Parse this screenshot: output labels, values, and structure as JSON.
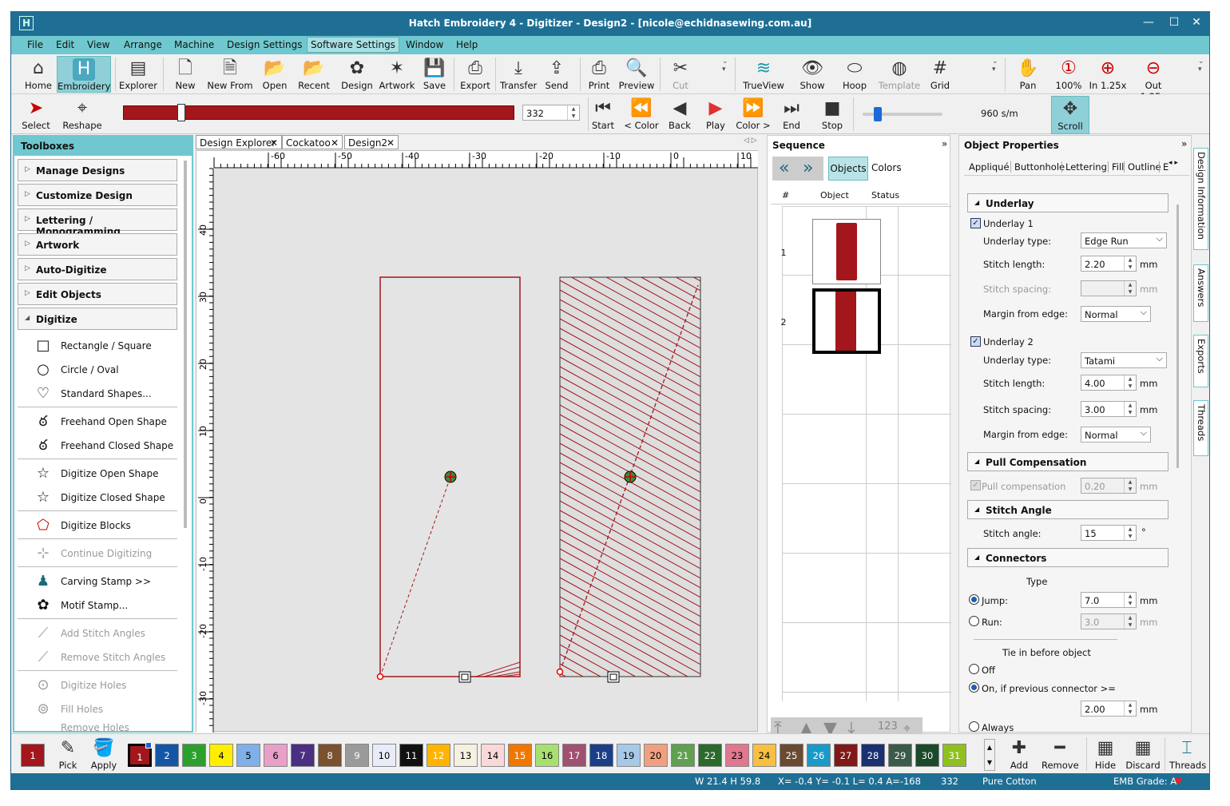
{
  "title": "Hatch Embroidery 4 - Digitizer - Design2 - [nicole@echidnasewing.com.au]",
  "menu": [
    "File",
    "Edit",
    "View",
    "Arrange",
    "Machine",
    "Design Settings",
    "Software Settings",
    "Window",
    "Help"
  ],
  "toolbar": {
    "home": "Home",
    "embroidery": "Embroidery",
    "explorer": "Explorer",
    "new": "New",
    "new_from": "New From",
    "open": "Open",
    "recent": "Recent",
    "design": "Design",
    "artwork": "Artwork",
    "save": "Save",
    "export": "Export",
    "transfer": "Transfer",
    "send": "Send",
    "print": "Print",
    "preview": "Preview",
    "cut": "Cut",
    "trueview": "TrueView",
    "show": "Show",
    "hoop": "Hoop",
    "template": "Template",
    "grid": "Grid",
    "pan": "Pan",
    "zoom100": "100%",
    "zoom_in": "In 1.25x",
    "zoom_out": "Out 1.25x"
  },
  "toolbar2": {
    "select": "Select",
    "reshape": "Reshape",
    "stitch_count": "332",
    "start": "Start",
    "prev_color": "< Color",
    "back": "Back",
    "play": "Play",
    "next_color": "Color >",
    "end": "End",
    "stop": "Stop",
    "speed": "960 s/m",
    "scroll": "Scroll",
    "slider_level": 0.1
  },
  "toolboxes": {
    "header": "Toolboxes",
    "categories": [
      "Manage Designs",
      "Customize Design",
      "Lettering / Monogramming",
      "Artwork",
      "Auto-Digitize",
      "Edit Objects",
      "Digitize"
    ],
    "tools": [
      "Rectangle / Square",
      "Circle / Oval",
      "Standard Shapes...",
      "Freehand Open Shape",
      "Freehand Closed Shape",
      "Digitize Open Shape",
      "Digitize Closed Shape",
      "Digitize Blocks",
      "Continue Digitizing",
      "Carving Stamp >>",
      "Motif Stamp...",
      "Add Stitch Angles",
      "Remove Stitch Angles",
      "Digitize Holes",
      "Fill Holes",
      "Remove Holes"
    ]
  },
  "doc_tabs": [
    "Design Explorer",
    "Cockatoo",
    "Design2"
  ],
  "ruler": {
    "h": [
      "-60",
      "-50",
      "-40",
      "-30",
      "-20",
      "-10",
      "0",
      "10"
    ],
    "v": [
      "40",
      "30",
      "20",
      "10",
      "0",
      "-10",
      "-20",
      "-30"
    ]
  },
  "sequence": {
    "title": "Sequence",
    "objects_tab": "Objects",
    "colors_tab": "Colors",
    "col_num": "#",
    "col_object": "Object",
    "col_status": "Status",
    "rows": [
      "1",
      "2"
    ],
    "counter": "123"
  },
  "props": {
    "title": "Object Properties",
    "tabs": [
      "Appliqué",
      "Buttonhole",
      "Lettering",
      "Fill",
      "Outline",
      "E"
    ],
    "underlay": "Underlay",
    "underlay1": "Underlay 1",
    "u1_type_lbl": "Underlay type:",
    "u1_type": "Edge Run",
    "u1_len_lbl": "Stitch length:",
    "u1_len": "2.20",
    "u1_spacing_lbl": "Stitch spacing:",
    "u1_margin_lbl": "Margin from edge:",
    "u1_margin": "Normal",
    "underlay2": "Underlay 2",
    "u2_type_lbl": "Underlay type:",
    "u2_type": "Tatami",
    "u2_len_lbl": "Stitch length:",
    "u2_len": "4.00",
    "u2_spacing_lbl": "Stitch spacing:",
    "u2_spacing": "3.00",
    "u2_margin_lbl": "Margin from edge:",
    "u2_margin": "Normal",
    "pull": "Pull Compensation",
    "pull_lbl": "Pull compensation",
    "pull_val": "0.20",
    "angle": "Stitch Angle",
    "angle_lbl": "Stitch angle:",
    "angle_val": "15",
    "deg": "°",
    "connectors": "Connectors",
    "type": "Type",
    "jump": "Jump:",
    "jump_val": "7.0",
    "run": "Run:",
    "run_val": "3.0",
    "tie": "Tie in before object",
    "off": "Off",
    "on_prev": "On, if previous connector >=",
    "on_val": "2.00",
    "always": "Always",
    "mm": "mm"
  },
  "side_tabs": [
    "Design Information",
    "Answers",
    "Exports",
    "Threads"
  ],
  "palette": {
    "pick": "Pick",
    "apply": "Apply",
    "add": "Add",
    "remove": "Remove",
    "hide": "Hide",
    "discard": "Discard",
    "threads": "Threads",
    "current": "1",
    "current_color": "#a3171c",
    "swatches": [
      {
        "n": "1",
        "c": "#a3171c"
      },
      {
        "n": "2",
        "c": "#1356a6"
      },
      {
        "n": "3",
        "c": "#2ca02c"
      },
      {
        "n": "4",
        "c": "#ffee00"
      },
      {
        "n": "5",
        "c": "#7fb0e8"
      },
      {
        "n": "6",
        "c": "#e8a0c8"
      },
      {
        "n": "7",
        "c": "#4a2f82"
      },
      {
        "n": "8",
        "c": "#7a5230"
      },
      {
        "n": "9",
        "c": "#9a9a9a"
      },
      {
        "n": "10",
        "c": "#e8ecf8"
      },
      {
        "n": "11",
        "c": "#111111"
      },
      {
        "n": "12",
        "c": "#ffb400"
      },
      {
        "n": "13",
        "c": "#f5f0e0"
      },
      {
        "n": "14",
        "c": "#fbd8d8"
      },
      {
        "n": "15",
        "c": "#f07800"
      },
      {
        "n": "16",
        "c": "#a8e070"
      },
      {
        "n": "17",
        "c": "#a05070"
      },
      {
        "n": "18",
        "c": "#1a3f88"
      },
      {
        "n": "19",
        "c": "#a8c8e8"
      },
      {
        "n": "20",
        "c": "#f0a080"
      },
      {
        "n": "21",
        "c": "#60a050"
      },
      {
        "n": "22",
        "c": "#2a6a2a"
      },
      {
        "n": "23",
        "c": "#e07890"
      },
      {
        "n": "24",
        "c": "#f8c040"
      },
      {
        "n": "25",
        "c": "#6a4a30"
      },
      {
        "n": "26",
        "c": "#1a9ac8"
      },
      {
        "n": "27",
        "c": "#801818"
      },
      {
        "n": "28",
        "c": "#1a3070"
      },
      {
        "n": "29",
        "c": "#3a5a4a"
      },
      {
        "n": "30",
        "c": "#1a4a2a"
      },
      {
        "n": "31",
        "c": "#90c020"
      }
    ]
  },
  "status": {
    "dims": "W  21.4 H  59.8",
    "coords": "X=  -0.4 Y=  -0.1 L=  0.4 A=-168",
    "count": "332",
    "thread": "Pure Cotton",
    "grade": "EMB Grade: A"
  },
  "colors": {
    "accent": "#6fc8cf",
    "title": "#1f6f95",
    "stitch": "#a3171c"
  }
}
